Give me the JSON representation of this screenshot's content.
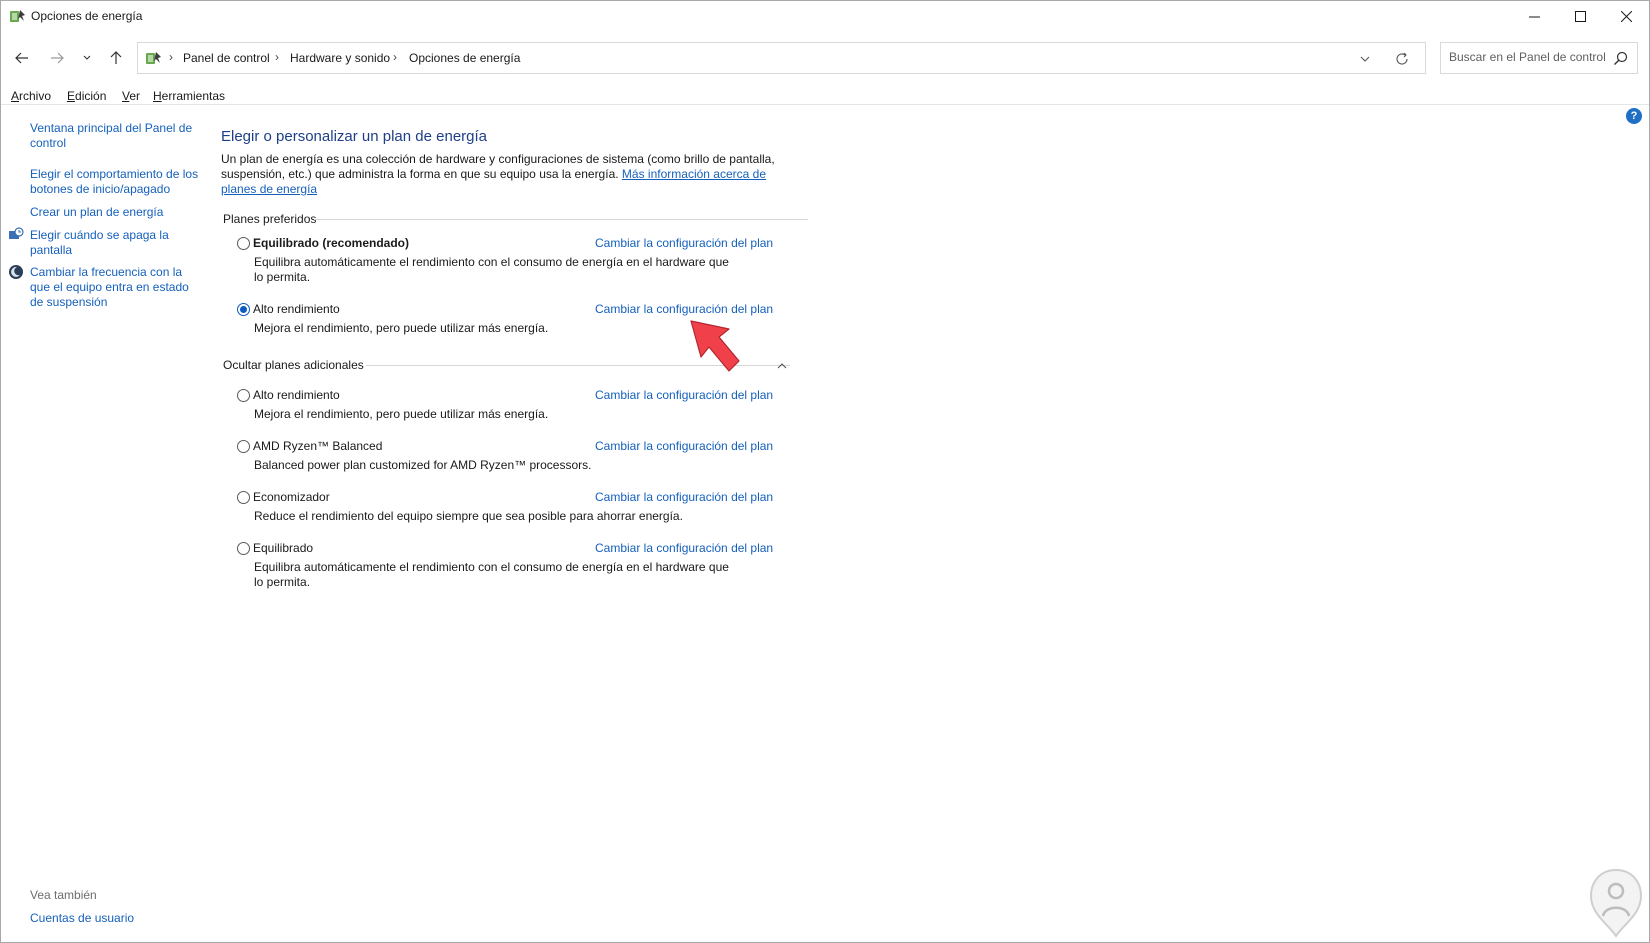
{
  "window": {
    "title": "Opciones de energía"
  },
  "address": {
    "breadcrumbs": [
      "Panel de control",
      "Hardware y sonido",
      "Opciones de energía"
    ],
    "search_placeholder": "Buscar en el Panel de control"
  },
  "menubar": {
    "items": [
      {
        "accel": "A",
        "rest": "rchivo"
      },
      {
        "accel": "E",
        "rest": "dición"
      },
      {
        "accel": "V",
        "rest": "er"
      },
      {
        "accel": "H",
        "rest": "erramientas"
      }
    ]
  },
  "sidebar": {
    "links": [
      "Ventana principal del Panel de control",
      "Elegir el comportamiento de los botones de inicio/apagado",
      "Crear un plan de energía",
      "Elegir cuándo se apaga la pantalla",
      "Cambiar la frecuencia con la que el equipo entra en estado de suspensión"
    ],
    "see_also_label": "Vea también",
    "see_also_links": [
      "Cuentas de usuario"
    ]
  },
  "main": {
    "title": "Elegir o personalizar un plan de energía",
    "intro_text": "Un plan de energía es una colección de hardware y configuraciones de sistema (como brillo de pantalla, suspensión, etc.) que administra la forma en que su equipo usa la energía.",
    "intro_link": "Más información acerca de planes de energía",
    "preferred_header": "Planes preferidos",
    "additional_header": "Ocultar planes adicionales",
    "change_link": "Cambiar la configuración del plan",
    "preferred_plans": [
      {
        "name": "Equilibrado (recomendado)",
        "desc": "Equilibra automáticamente el rendimiento con el consumo de energía en el hardware que lo permita.",
        "selected": false
      },
      {
        "name": "Alto rendimiento",
        "desc": "Mejora el rendimiento, pero puede utilizar más energía.",
        "selected": true
      }
    ],
    "additional_plans": [
      {
        "name": "Alto rendimiento",
        "desc": "Mejora el rendimiento, pero puede utilizar más energía.",
        "selected": false
      },
      {
        "name": "AMD Ryzen™ Balanced",
        "desc": "Balanced power plan customized for AMD Ryzen™ processors.",
        "selected": false
      },
      {
        "name": "Economizador",
        "desc": "Reduce el rendimiento del equipo siempre que sea posible para ahorrar energía.",
        "selected": false
      },
      {
        "name": "Equilibrado",
        "desc": "Equilibra automáticamente el rendimiento con el consumo de energía en el hardware que lo permita.",
        "selected": false
      }
    ]
  },
  "colors": {
    "link": "#1560bd",
    "title": "#1e3f87",
    "radio_selected": "#0a5bbf",
    "pointer_arrow": "#f0414b"
  },
  "icons": {
    "app": "power-options-icon",
    "back": "arrow-left-icon",
    "forward": "arrow-right-icon",
    "up": "arrow-up-icon",
    "search": "search-icon",
    "help": "help-icon"
  }
}
